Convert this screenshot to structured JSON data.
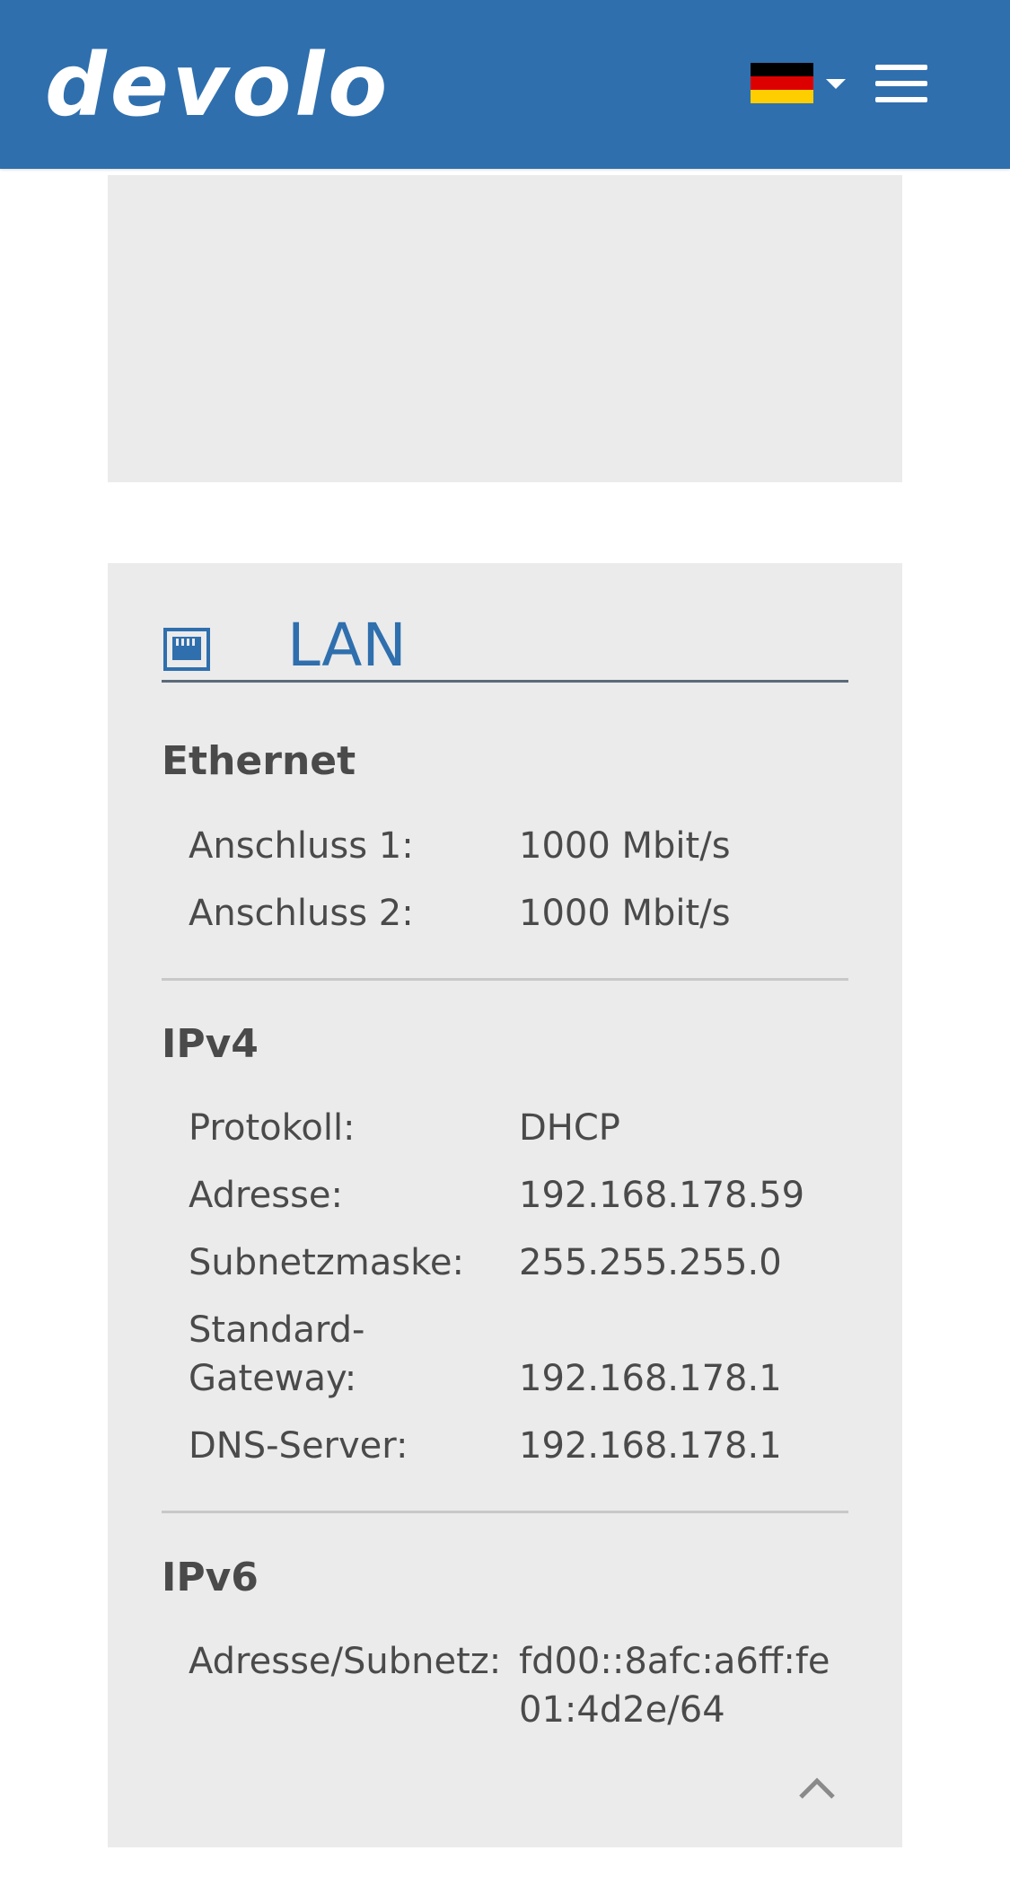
{
  "header": {
    "logo_text": "devolo",
    "language": "Deutsch",
    "brand_color": "#2f6fae"
  },
  "lan": {
    "title": "LAN",
    "icon": "ethernet-port-icon",
    "ethernet": {
      "title": "Ethernet",
      "rows": [
        {
          "label": "Anschluss 1:",
          "value": "1000 Mbit/s"
        },
        {
          "label": "Anschluss 2:",
          "value": "1000 Mbit/s"
        }
      ]
    },
    "ipv4": {
      "title": "IPv4",
      "rows": [
        {
          "label": "Protokoll:",
          "value": "DHCP"
        },
        {
          "label": "Adresse:",
          "value": "192.168.178.59"
        },
        {
          "label": "Subnetzmaske:",
          "value": "255.255.255.0"
        },
        {
          "label": "Standard-Gateway:",
          "value": "192.168.178.1"
        },
        {
          "label": "DNS-Server:",
          "value": "192.168.178.1"
        }
      ]
    },
    "ipv6": {
      "title": "IPv6",
      "rows": [
        {
          "label": "Adresse/Subnetz:",
          "value": "fd00::8afc:a6ff:fe01:4d2e/64"
        }
      ]
    }
  }
}
